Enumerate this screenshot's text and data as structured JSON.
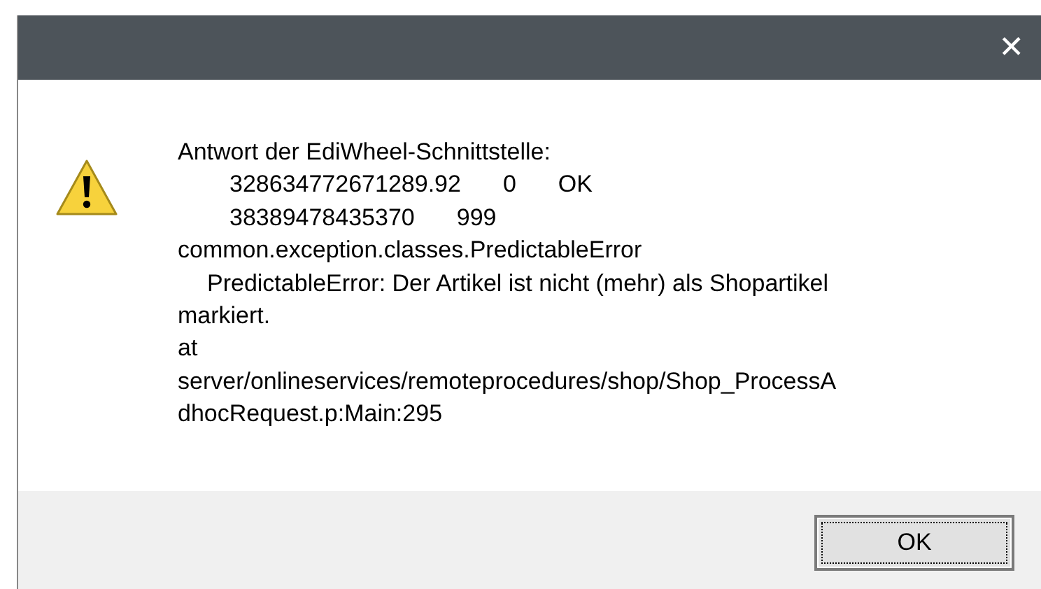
{
  "window": {
    "close_button": "✕"
  },
  "message": {
    "lines": [
      {
        "kind": "text",
        "text": "Antwort der EdiWheel-Schnittstelle:"
      },
      {
        "kind": "values",
        "cells": [
          "328634772671289.92",
          "0",
          "OK"
        ]
      },
      {
        "kind": "values",
        "cells": [
          "38389478435370",
          "999"
        ]
      },
      {
        "kind": "text",
        "text": "common.exception.classes.PredictableError"
      },
      {
        "kind": "indented",
        "text": "PredictableError: Der Artikel ist nicht (mehr) als Shopartikel"
      },
      {
        "kind": "text",
        "text": "markiert."
      },
      {
        "kind": "text",
        "text": "at"
      },
      {
        "kind": "text",
        "text": "server/onlineservices/remoteprocedures/shop/Shop_ProcessA"
      },
      {
        "kind": "text",
        "text": "dhocRequest.p:Main:295"
      }
    ]
  },
  "buttons": [
    {
      "label": "OK",
      "selected": true
    }
  ]
}
